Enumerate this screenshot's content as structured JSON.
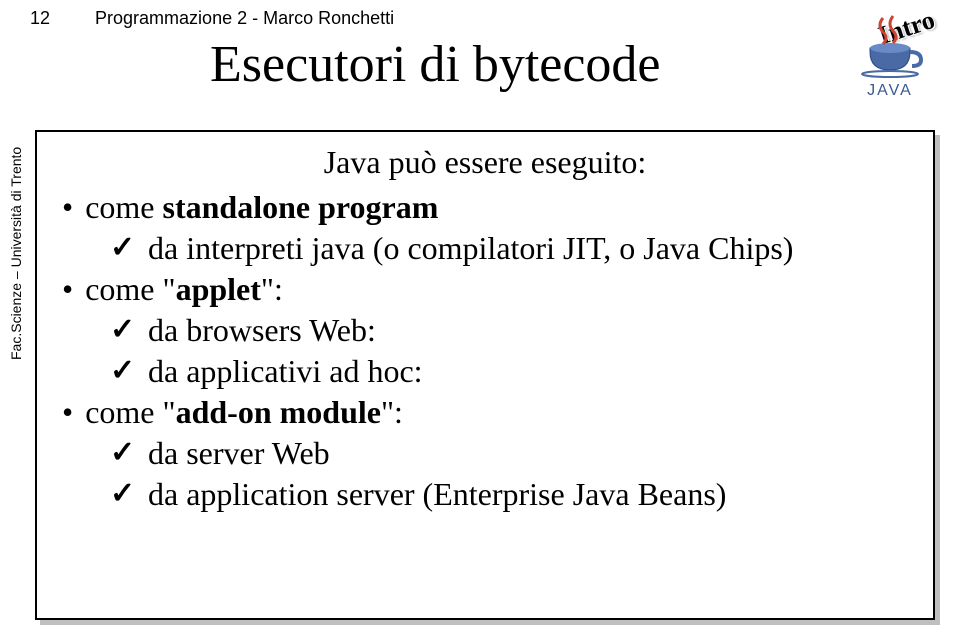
{
  "header": {
    "page_number": "12",
    "course": "Programmazione 2   -   Marco Ronchetti"
  },
  "sidebar": {
    "affiliation": "Fac.Scienze – Università di Trento"
  },
  "logo": {
    "brand": "JAVA",
    "badge": "Intro"
  },
  "slide": {
    "title": "Esecutori di bytecode",
    "intro": "Java può essere eseguito:",
    "items": [
      {
        "prefix": "come ",
        "bold": "standalone program",
        "sub": [
          {
            "text": " da interpreti java (o compilatori JIT, o Java Chips)"
          }
        ]
      },
      {
        "prefix": "come \"",
        "bold": "applet",
        "suffix": "\":",
        "sub": [
          {
            "text": "da browsers Web:"
          },
          {
            "text": "da applicativi ad hoc:"
          }
        ]
      },
      {
        "prefix": "come \"",
        "bold": "add-on module",
        "suffix": "\":",
        "sub": [
          {
            "text": "da server Web"
          },
          {
            "text": "da application server (Enterprise Java Beans)"
          }
        ]
      }
    ]
  }
}
